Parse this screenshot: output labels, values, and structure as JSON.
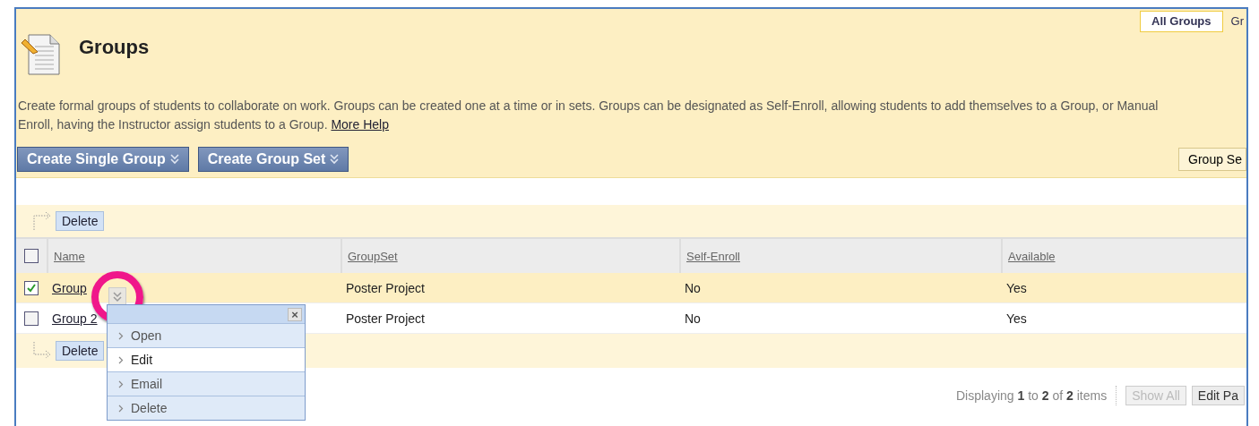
{
  "nav_tabs": [
    {
      "label": "All Groups",
      "selected": true
    },
    {
      "label": "Gr",
      "selected": false
    }
  ],
  "page": {
    "title": "Groups",
    "description": "Create formal groups of students to collaborate on work. Groups can be created one at a time or in sets. Groups can be designated as Self-Enroll, allowing students to add themselves to a Group, or Manual\nEnroll, having the Instructor assign students to a Group.",
    "help_link": "More Help"
  },
  "action_buttons": [
    {
      "label": "Create Single Group"
    },
    {
      "label": "Create Group Set"
    }
  ],
  "right_button": "Group Se",
  "top_action": "Delete",
  "bottom_action": "Delete",
  "table": {
    "select_all_checked": false,
    "columns": [
      "Name",
      "GroupSet",
      "Self-Enroll",
      "Available"
    ],
    "rows": [
      {
        "checked": true,
        "name": "Group",
        "groupset": "Poster Project",
        "self_enroll": "No",
        "available": "Yes"
      },
      {
        "checked": false,
        "name": "Group 2",
        "groupset": "Poster Project",
        "self_enroll": "No",
        "available": "Yes"
      }
    ]
  },
  "context_menu": {
    "close": "×",
    "items": [
      {
        "label": "Open",
        "selected": false
      },
      {
        "label": "Edit",
        "selected": true
      },
      {
        "label": "Email",
        "selected": false
      },
      {
        "label": "Delete",
        "selected": false
      }
    ]
  },
  "pagination": {
    "summary": "Displaying **1** to **2** of **2** items",
    "buttons": [
      {
        "label": "Show All",
        "disabled": true
      },
      {
        "label": "Edit Pa",
        "disabled": false
      }
    ]
  }
}
